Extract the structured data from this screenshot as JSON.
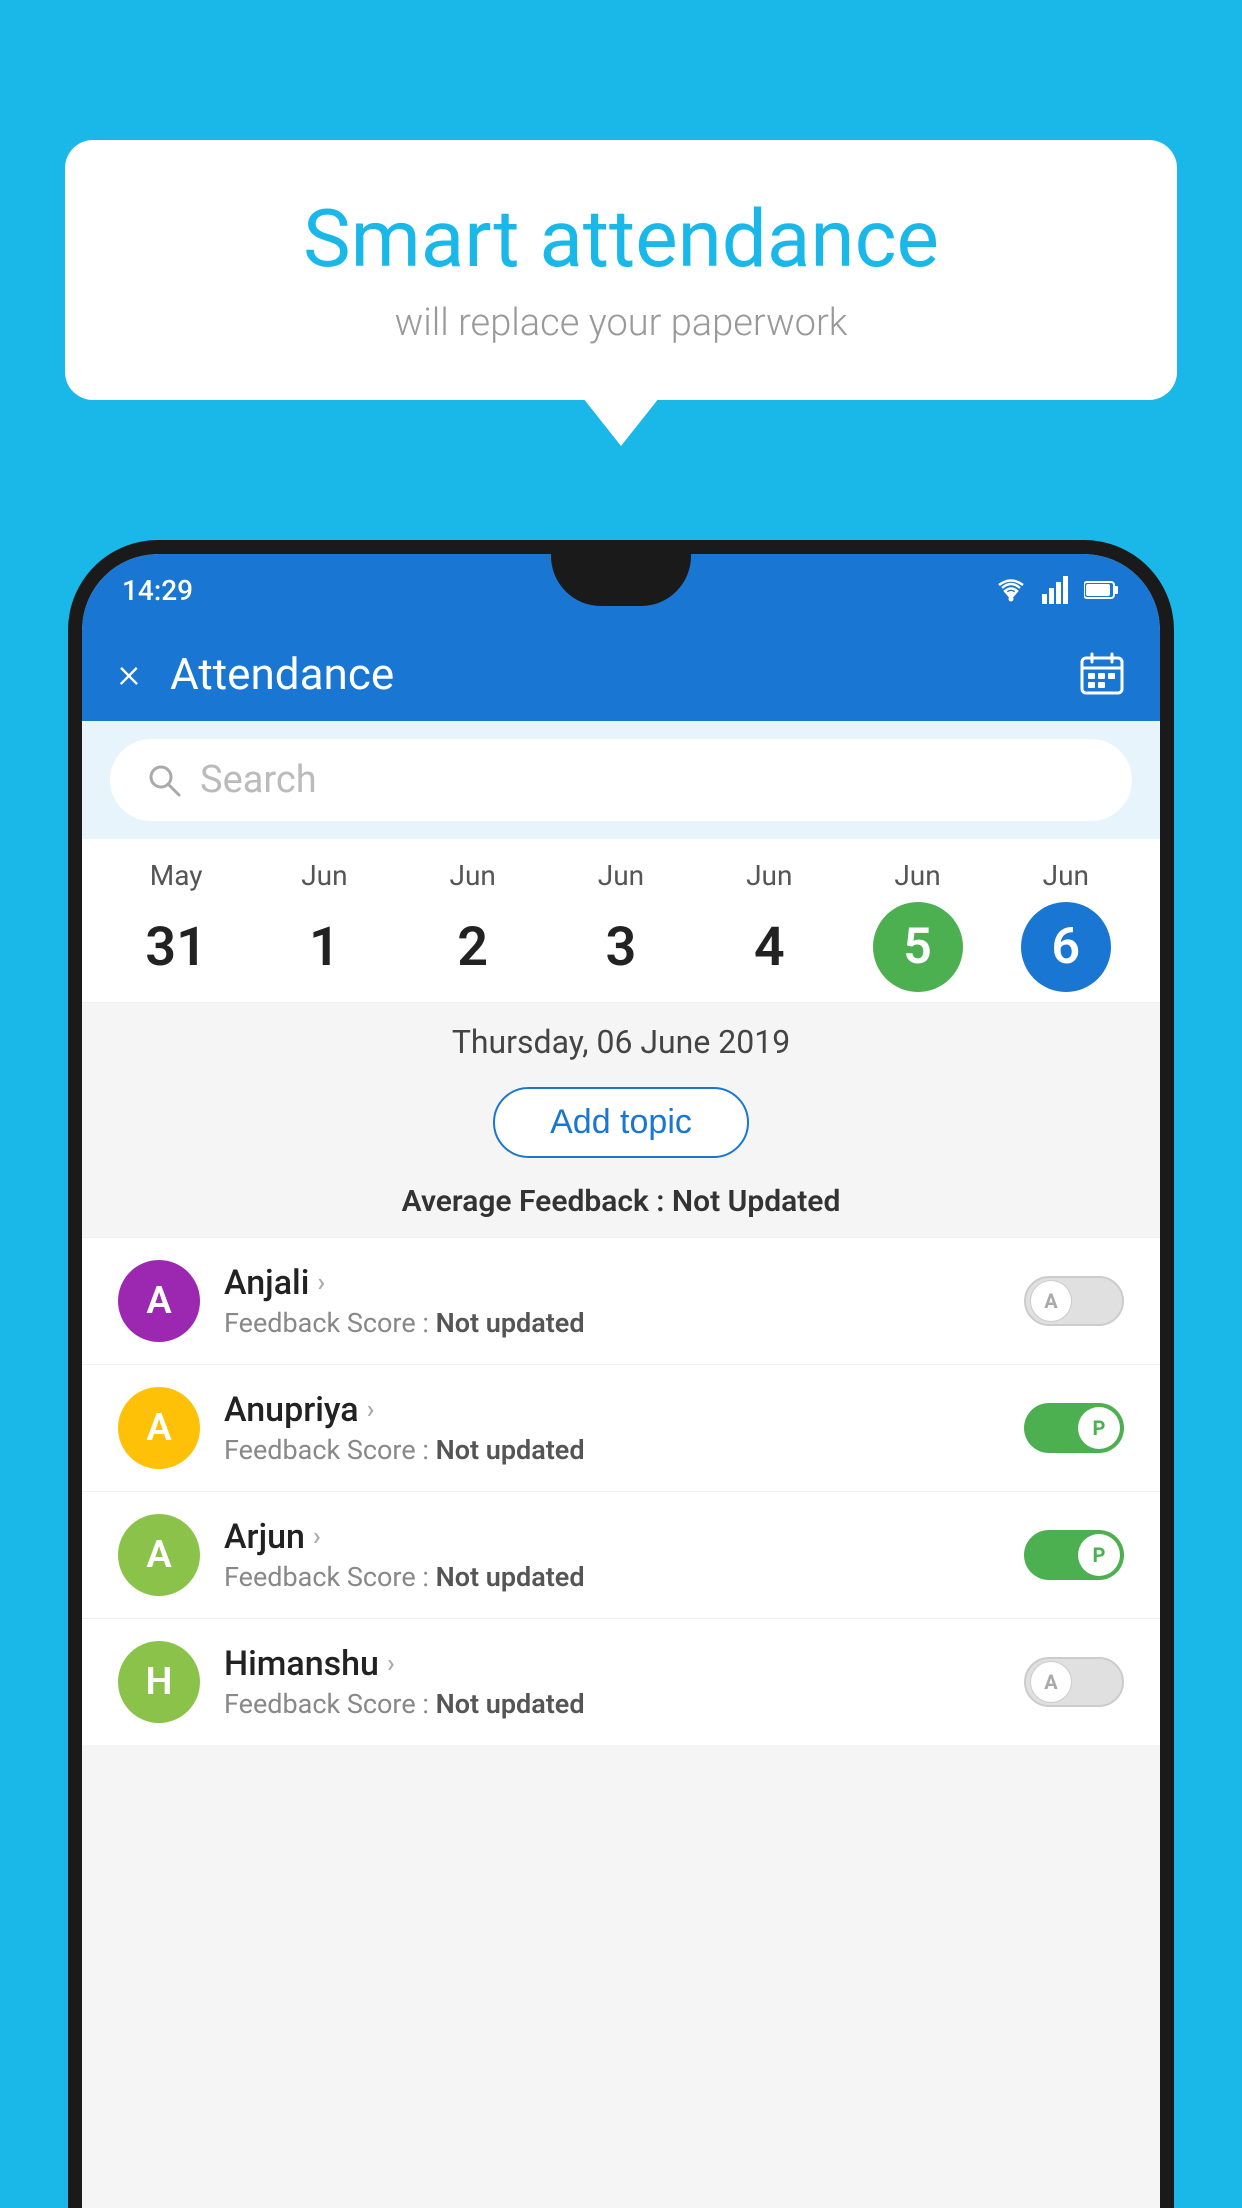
{
  "background_color": "#1ab8e8",
  "bubble": {
    "title": "Smart attendance",
    "subtitle": "will replace your paperwork"
  },
  "status_bar": {
    "time": "14:29",
    "icons": [
      "wifi",
      "signal",
      "battery"
    ]
  },
  "header": {
    "title": "Attendance",
    "close_label": "×",
    "calendar_icon": "📅"
  },
  "search": {
    "placeholder": "Search"
  },
  "dates": [
    {
      "month": "May",
      "day": "31",
      "style": "normal"
    },
    {
      "month": "Jun",
      "day": "1",
      "style": "normal"
    },
    {
      "month": "Jun",
      "day": "2",
      "style": "normal"
    },
    {
      "month": "Jun",
      "day": "3",
      "style": "normal"
    },
    {
      "month": "Jun",
      "day": "4",
      "style": "normal"
    },
    {
      "month": "Jun",
      "day": "5",
      "style": "green"
    },
    {
      "month": "Jun",
      "day": "6",
      "style": "blue"
    }
  ],
  "selected_date": "Thursday, 06 June 2019",
  "add_topic_label": "Add topic",
  "avg_feedback_label": "Average Feedback :",
  "avg_feedback_value": "Not Updated",
  "students": [
    {
      "name": "Anjali",
      "avatar_letter": "A",
      "avatar_color": "#9c27b0",
      "feedback_label": "Feedback Score :",
      "feedback_value": "Not updated",
      "toggle": "off",
      "toggle_letter": "A"
    },
    {
      "name": "Anupriya",
      "avatar_letter": "A",
      "avatar_color": "#ffc107",
      "feedback_label": "Feedback Score :",
      "feedback_value": "Not updated",
      "toggle": "on",
      "toggle_letter": "P"
    },
    {
      "name": "Arjun",
      "avatar_letter": "A",
      "avatar_color": "#8bc34a",
      "feedback_label": "Feedback Score :",
      "feedback_value": "Not updated",
      "toggle": "on",
      "toggle_letter": "P"
    },
    {
      "name": "Himanshu",
      "avatar_letter": "H",
      "avatar_color": "#8bc34a",
      "feedback_label": "Feedback Score :",
      "feedback_value": "Not updated",
      "toggle": "off",
      "toggle_letter": "A"
    }
  ]
}
